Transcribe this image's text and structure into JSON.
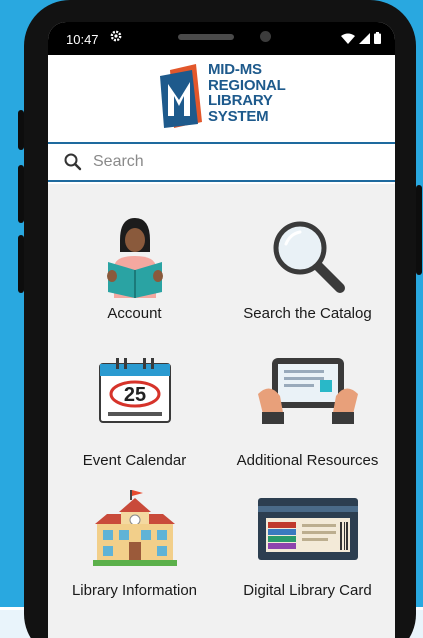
{
  "status_bar": {
    "time": "10:47"
  },
  "logo": {
    "lines": [
      "MID-MS",
      "REGIONAL",
      "LIBRARY",
      "SYSTEM"
    ]
  },
  "search": {
    "placeholder": "Search"
  },
  "menu": {
    "account": "Account",
    "search_catalog": "Search the Catalog",
    "event_calendar": "Event Calendar",
    "calendar_day": "25",
    "additional_resources": "Additional Resources",
    "library_information": "Library Information",
    "digital_library_card": "Digital Library Card"
  },
  "colors": {
    "brand_blue": "#1e5a8c",
    "brand_orange": "#e2572b",
    "background": "#29a8e0"
  }
}
